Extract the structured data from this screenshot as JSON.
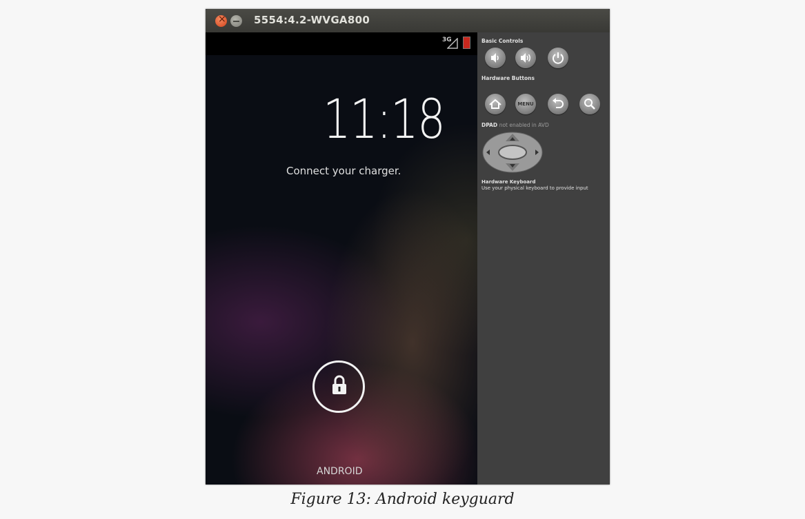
{
  "window": {
    "title": "5554:4.2-WVGA800"
  },
  "phone": {
    "network": "3G",
    "time": "11:18",
    "status_message": "Connect your charger.",
    "carrier": "ANDROID"
  },
  "panel": {
    "basic_controls": "Basic Controls",
    "hardware_buttons": "Hardware Buttons",
    "dpad_label": "DPAD",
    "dpad_note": "not enabled in AVD",
    "keyboard_title": "Hardware Keyboard",
    "keyboard_desc": "Use your physical keyboard to provide input",
    "menu_label": "MENU"
  },
  "caption": "Figure 13: Android keyguard",
  "colors": {
    "battery": "#c8281e",
    "close_button": "#e05a2f",
    "panel_bg": "#404040"
  }
}
